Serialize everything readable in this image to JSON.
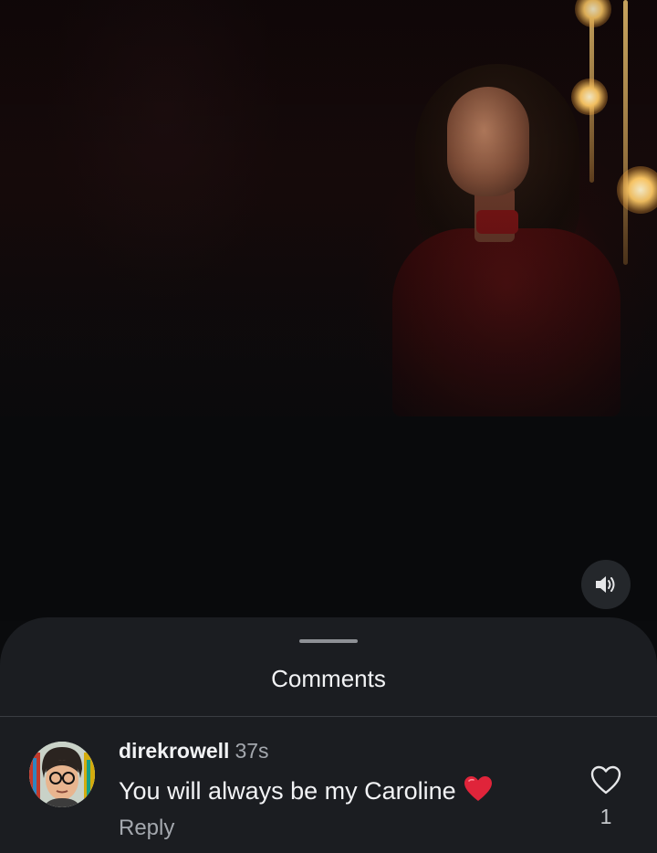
{
  "video": {
    "sound_icon": "speaker-volume-icon"
  },
  "comments_sheet": {
    "title": "Comments"
  },
  "comments": [
    {
      "username": "direkrowell",
      "time": "37s",
      "text": "You will always be my Caroline",
      "emoji": "red-heart-emoji",
      "reply_label": "Reply",
      "likes": "1",
      "like_icon": "heart-outline-icon",
      "avatar_icon": "avatar-illustration-icon"
    }
  ],
  "colors": {
    "sheet_background": "#1b1d21",
    "video_background": "#090a0c",
    "secondary_text": "#a4a8ae",
    "emoji_heart": "#e0243a"
  }
}
